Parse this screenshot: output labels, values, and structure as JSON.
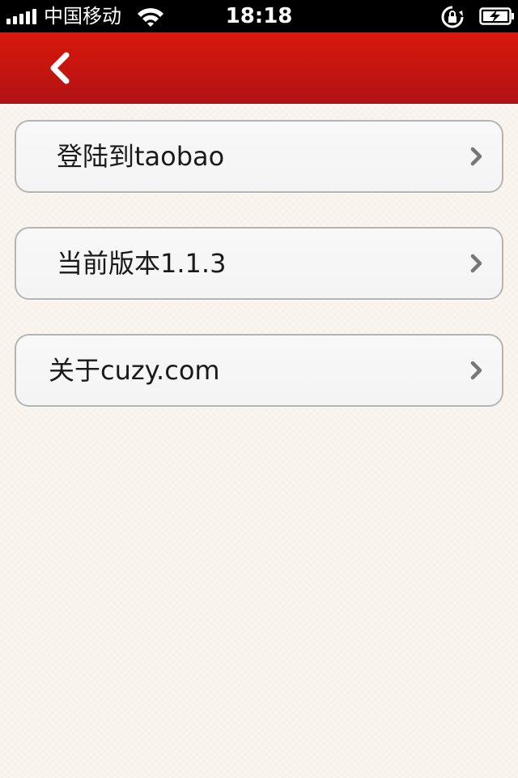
{
  "status_bar": {
    "carrier": "中国移动",
    "time": "18:18",
    "icons": [
      "signal-bars-icon",
      "wifi-icon",
      "rotation-lock-icon",
      "battery-charging-icon"
    ]
  },
  "nav_bar": {
    "back_icon": "chevron-left-icon",
    "accent_color": "#c41510"
  },
  "menu": {
    "items": [
      {
        "label": "登陆到taobao",
        "icon": "chevron-right-icon"
      },
      {
        "label": "当前版本1.1.3",
        "icon": "chevron-right-icon"
      },
      {
        "label": "关于cuzy.com",
        "icon": "chevron-right-icon"
      }
    ]
  }
}
